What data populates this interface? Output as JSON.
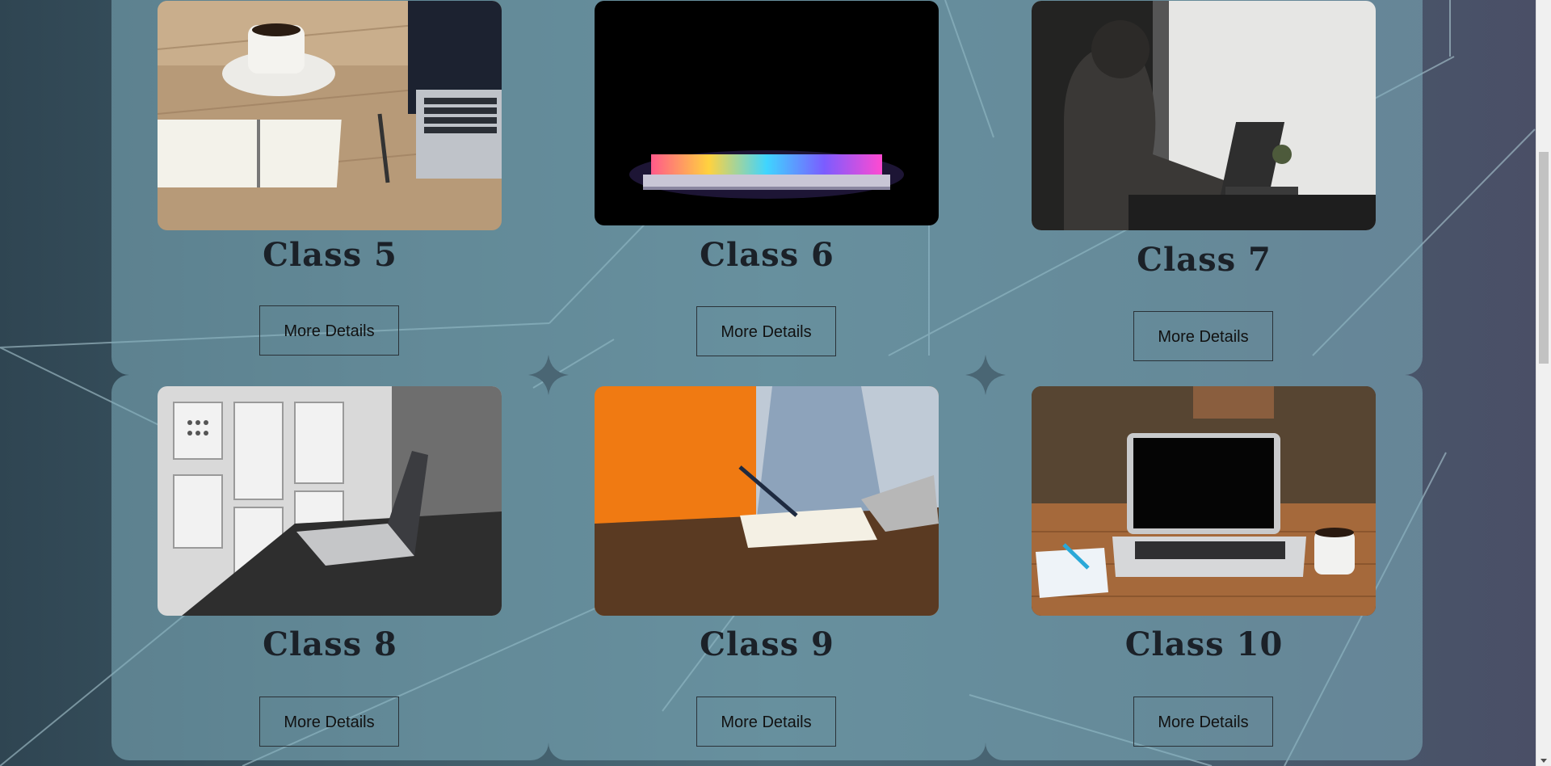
{
  "classes": [
    {
      "title": "Class 5",
      "button": "More Details",
      "photo": "notebook-coffee-laptop"
    },
    {
      "title": "Class 6",
      "button": "More Details",
      "photo": "glowing-laptop"
    },
    {
      "title": "Class 7",
      "button": "More Details",
      "photo": "woman-working-laptop"
    },
    {
      "title": "Class 8",
      "button": "More Details",
      "photo": "laptop-office-shelves"
    },
    {
      "title": "Class 9",
      "button": "More Details",
      "photo": "man-writing-orange-wall"
    },
    {
      "title": "Class 10",
      "button": "More Details",
      "photo": "laptop-cafe-table"
    }
  ],
  "colors": {
    "card": "#80afbe",
    "title": "#1b2128",
    "background": "#3f5b68"
  }
}
